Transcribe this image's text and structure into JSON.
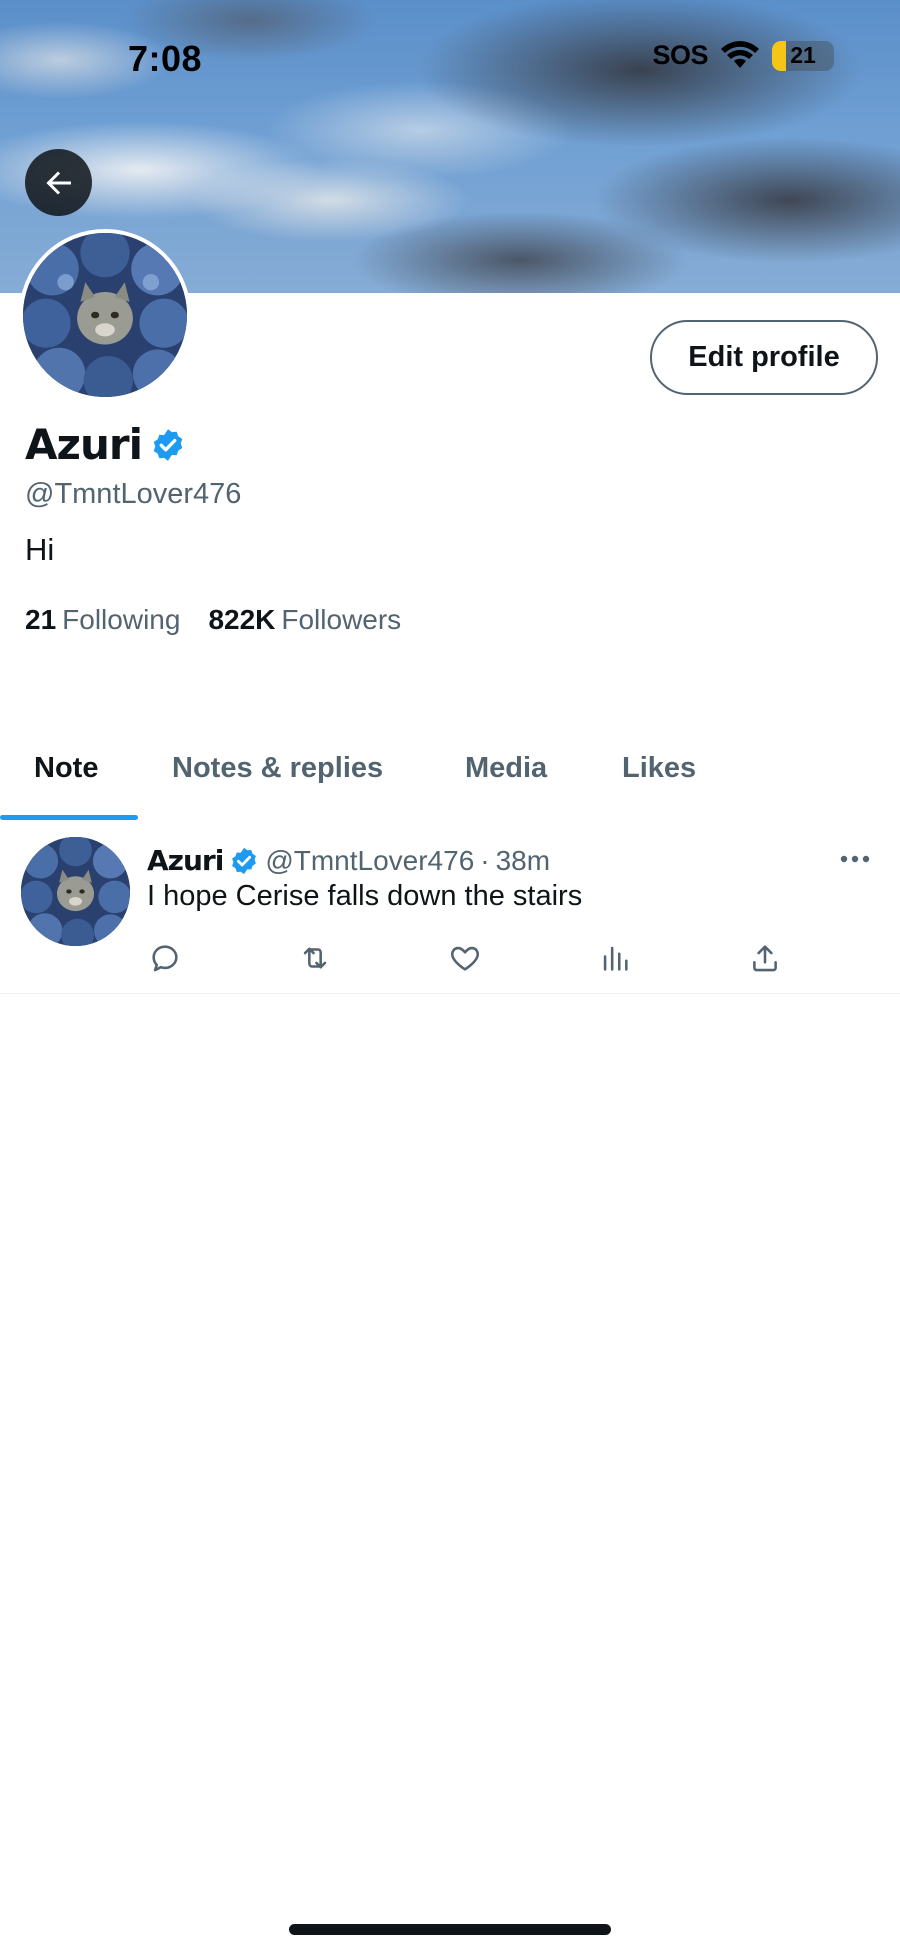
{
  "status_bar": {
    "time": "7:08",
    "sos": "SOS",
    "battery": "21"
  },
  "profile": {
    "display_name": "Azuri",
    "handle": "@TmntLover476",
    "bio": "Hi",
    "edit_button": "Edit profile",
    "following_count": "21",
    "following_label": "Following",
    "followers_count": "822K",
    "followers_label": "Followers"
  },
  "tabs": [
    {
      "label": "Note",
      "active": true
    },
    {
      "label": "Notes & replies",
      "active": false
    },
    {
      "label": "Media",
      "active": false
    },
    {
      "label": "Likes",
      "active": false
    }
  ],
  "post": {
    "name": "Azuri",
    "handle": "@TmntLover476",
    "separator": "·",
    "time": "38m",
    "text": "I hope Cerise falls down the stairs"
  },
  "icons": {
    "back": "arrow-left-icon",
    "verified": "verified-badge-icon",
    "more": "more-horizontal-icon",
    "reply": "reply-icon",
    "repost": "repost-icon",
    "like": "heart-icon",
    "views": "views-chart-icon",
    "share": "share-icon"
  },
  "colors": {
    "accent": "#1d9bf0",
    "text": "#0f1419",
    "muted": "#536471"
  }
}
